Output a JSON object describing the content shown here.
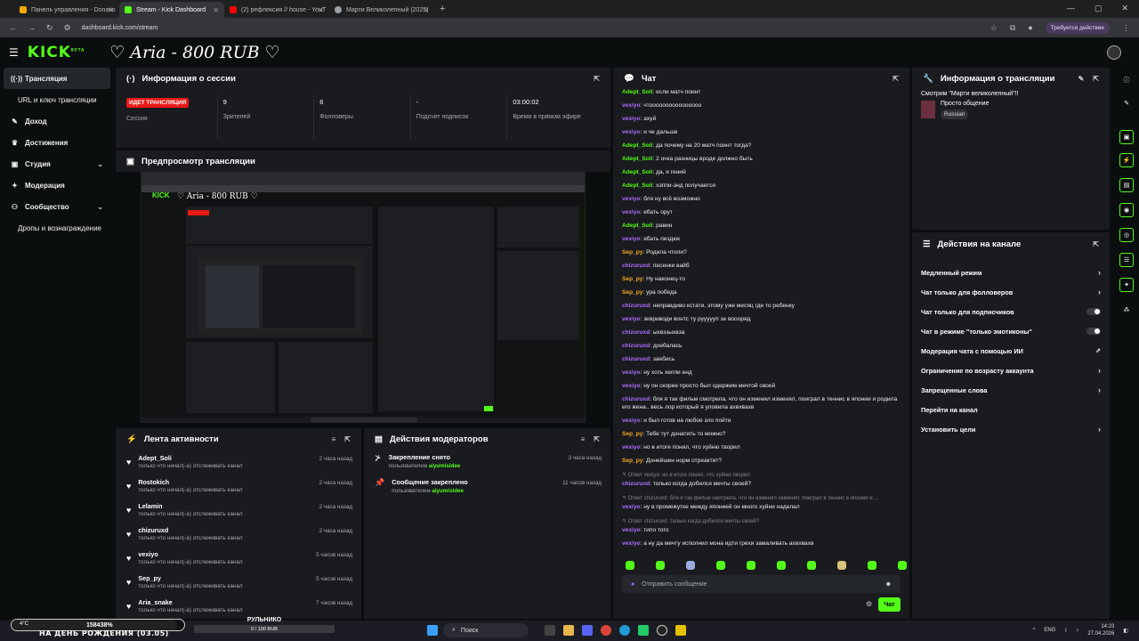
{
  "browser": {
    "tabs": [
      {
        "title": "Панель управления - Donatio",
        "color": "#f2a900"
      },
      {
        "title": "Stream - Kick Dashboard",
        "color": "#53fc18"
      },
      {
        "title": "(2) рефлексия // house - YouT",
        "color": "#ff0000"
      },
      {
        "title": "Марти Великолепный (2025)",
        "color": "#9aa0a6"
      }
    ],
    "url": "dashboard.kick.com/stream",
    "action_required": "Требуется действие"
  },
  "header": {
    "logo": "KICK",
    "logo_badge": "BETA",
    "channel_title": "♡ Aria - 800 RUB ♡"
  },
  "sidebar": {
    "items": [
      {
        "label": "Трансляция",
        "icon": "📡"
      },
      {
        "label": "URL и ключ трансляции",
        "icon": ""
      },
      {
        "label": "Доход",
        "icon": "✎"
      },
      {
        "label": "Достижения",
        "icon": "🏆"
      },
      {
        "label": "Студия",
        "icon": "⊞"
      },
      {
        "label": "Модерация",
        "icon": "🔧"
      },
      {
        "label": "Сообщество",
        "icon": "👥"
      },
      {
        "label": "Дропы и вознаграждение",
        "icon": ""
      }
    ]
  },
  "session": {
    "title": "Информация о сессии",
    "live_badge": "ИДЕТ ТРАНСЛЯЦИЯ",
    "stats": [
      {
        "value": "",
        "label": "Сессия"
      },
      {
        "value": "9",
        "label": "Зрителей"
      },
      {
        "value": "6",
        "label": "Фолловеры"
      },
      {
        "value": "-",
        "label": "Подсчет подписок"
      },
      {
        "value": "03:00:02",
        "label": "Время в прямом эфире"
      }
    ]
  },
  "preview": {
    "title": "Предпросмотр трансляции"
  },
  "activity": {
    "title": "Лента активности",
    "items": [
      {
        "name": "Adept_Soli",
        "sub": "только что начал(-а) отслеживать канал",
        "time": "2 часа назад"
      },
      {
        "name": "Rostokich",
        "sub": "только что начал(-а) отслеживать канал",
        "time": "2 часа назад"
      },
      {
        "name": "Lelamin",
        "sub": "только что начал(-а) отслеживать канал",
        "time": "2 часа назад"
      },
      {
        "name": "chizuruxd",
        "sub": "только что начал(-а) отслеживать канал",
        "time": "2 часа назад"
      },
      {
        "name": "vexiyo",
        "sub": "только что начал(-а) отслеживать канал",
        "time": "5 часов назад"
      },
      {
        "name": "Sep_py",
        "sub": "только что начал(-а) отслеживать канал",
        "time": "5 часов назад"
      },
      {
        "name": "Aria_snake",
        "sub": "только что начал(-а) отслеживать канал",
        "time": "7 часов назад"
      }
    ]
  },
  "mod_actions": {
    "title": "Действия модераторов",
    "items": [
      {
        "title": "Закрепление снято",
        "sub_prefix": "пользователем",
        "user": "aiyumisidee",
        "time": "3 часа назад"
      },
      {
        "title": "Сообщение закреплено",
        "sub_prefix": "пользователем",
        "user": "aiyumisidee",
        "time": "11 часов назад"
      }
    ]
  },
  "chat": {
    "title": "Чат",
    "messages": [
      {
        "user": "Adept_Soli",
        "color": "#53fc18",
        "text": "если матч поинт"
      },
      {
        "user": "vexiyo",
        "color": "#b06cff",
        "text": "чтоооооооооооооооо"
      },
      {
        "user": "vexiyo",
        "color": "#b06cff",
        "text": "ахуй"
      },
      {
        "user": "vexiyo",
        "color": "#b06cff",
        "text": "и че дальше"
      },
      {
        "user": "Adept_Soli",
        "color": "#53fc18",
        "text": "да почему на 20 матч поинт тогда?"
      },
      {
        "user": "Adept_Soli",
        "color": "#53fc18",
        "text": "2 очка разницы вроде должно быть"
      },
      {
        "user": "Adept_Soli",
        "color": "#53fc18",
        "text": "да, я гений"
      },
      {
        "user": "Adept_Soli",
        "color": "#53fc18",
        "text": "хэппи-энд получается"
      },
      {
        "user": "vexiyo",
        "color": "#b06cff",
        "text": "бля ну всё возможно"
      },
      {
        "user": "vexiyo",
        "color": "#b06cff",
        "text": "ебать орут"
      },
      {
        "user": "Adept_Soli",
        "color": "#53fc18",
        "text": "равин"
      },
      {
        "user": "vexiyo",
        "color": "#b06cff",
        "text": "ебать пиздюк"
      },
      {
        "user": "Sep_py",
        "color": "#f5a623",
        "text": "Родила чтоли?"
      },
      {
        "user": "chizuruxd",
        "color": "#b06cff",
        "text": "песенки вайб"
      },
      {
        "user": "Sep_py",
        "color": "#f5a623",
        "text": "Ну наконец-то"
      },
      {
        "user": "Sep_py",
        "color": "#f5a623",
        "text": "ура победа"
      },
      {
        "user": "chizuruxd",
        "color": "#b06cff",
        "text": "неправдиво кстати, этому уже месяц где то ребенку"
      },
      {
        "user": "vexiyo",
        "color": "#b06cff",
        "text": "зевриводи вонтс ту руууууп зе воооряд"
      },
      {
        "user": "chizuruxd",
        "color": "#b06cff",
        "text": "ыхвззыхвза"
      },
      {
        "user": "chizuruxd",
        "color": "#b06cff",
        "text": "доебалась"
      },
      {
        "user": "chizuruxd",
        "color": "#b06cff",
        "text": "заебись"
      },
      {
        "user": "vexiyo",
        "color": "#b06cff",
        "text": "ну хоть хеппи енд"
      },
      {
        "user": "vexiyo",
        "color": "#b06cff",
        "text": "ну он скорее просто был одержим мечтой своей"
      },
      {
        "user": "chizuruxd",
        "color": "#b06cff",
        "text": "бля я так фильм смотрела, что он изменял изменял, поиграл в теннис в японии и родила его жена.. весь лор который я уловила ахвхвахв"
      },
      {
        "user": "vexiyo",
        "color": "#b06cff",
        "text": "и был готов на любое зло пойти"
      },
      {
        "user": "Sep_py",
        "color": "#f5a623",
        "text": "Тебе тут донатить то можно?"
      },
      {
        "user": "vexiyo",
        "color": "#b06cff",
        "text": "но в итоге понял, что хуйню творил"
      },
      {
        "user": "Sep_py",
        "color": "#f5a623",
        "text": "Донейшен норм отреактит?"
      },
      {
        "reply": "↰ Ответ vexiyo: но в итоге понял, что хуйню творил",
        "user": "chizuruxd",
        "color": "#b06cff",
        "text": "только когда добился мечты своей?"
      },
      {
        "reply": "↰ Ответ chizuruxd: бля я так фильм смотрела, что он изменял изменял, поиграл в теннис в японии и ...",
        "user": "vexiyo",
        "color": "#b06cff",
        "text": "ну в промежутке между японией он много хуйни наделал"
      },
      {
        "reply": "↰ Ответ chizuruxd: только когда добился мечты своей?",
        "user": "vexiyo",
        "color": "#b06cff",
        "text": "типо того"
      },
      {
        "user": "vexiyo",
        "color": "#b06cff",
        "text": "а ну да мечту исполнил мона идти грехи замаливать ахвхвахв"
      }
    ],
    "input_placeholder": "Отправить сообщение",
    "send_label": "Чат"
  },
  "stream_info": {
    "title": "Информация о трансляции",
    "stream_title": "Смотрим \"Марти великолепный\"!!",
    "category": "Просто общение",
    "language": "Russian"
  },
  "channel_actions": {
    "title": "Действия на канале",
    "items": [
      {
        "label": "Медленный режим",
        "control": "chevron"
      },
      {
        "label": "Чат только для фолловеров",
        "control": "chevron"
      },
      {
        "label": "Чат только для подписчиков",
        "control": "toggle"
      },
      {
        "label": "Чат в режиме \"только эмотиконы\"",
        "control": "toggle"
      },
      {
        "label": "Модерация чата с помощью ИИ",
        "control": "external"
      },
      {
        "label": "Ограничение по возрасту аккаунта",
        "control": "chevron"
      },
      {
        "label": "Запрещенные слова",
        "control": "chevron"
      },
      {
        "label": "Перейти на канал",
        "control": "none"
      },
      {
        "label": "Установить цели",
        "control": "chevron"
      }
    ]
  },
  "overlay": {
    "weather": "4°C",
    "progress_text": "158438%",
    "birthday": "НА ДЕНЬ РОЖДЕНИЯ (03.05)",
    "goal_name": "РУЛЬНИКО",
    "goal_value": "0 / 100 RUB"
  },
  "taskbar": {
    "search": "Поиск",
    "lang": "ENG",
    "time": "14:23",
    "date": "27.04.2026"
  },
  "colors": {
    "accent": "#53fc18",
    "live": "#e91916",
    "panel": "#191b1f"
  }
}
